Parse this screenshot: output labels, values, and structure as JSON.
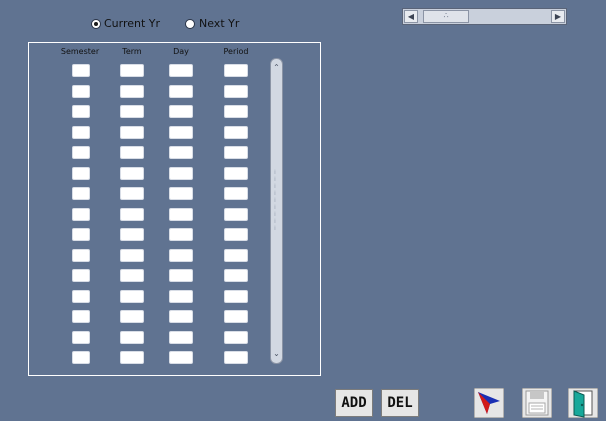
{
  "year_selector": {
    "options": [
      {
        "label": "Current  Yr",
        "checked": true
      },
      {
        "label": "Next  Yr",
        "checked": false
      }
    ]
  },
  "table": {
    "headers": [
      "Semester",
      "Term",
      "Day",
      "Period"
    ],
    "row_count": 15
  },
  "scroll": {
    "h_thumb_glyph": "∴",
    "v_up_glyph": "⌃",
    "v_down_glyph": "⌄",
    "v_grip": "⁞"
  },
  "toolbar": {
    "add_label": "ADD",
    "del_label": "DEL",
    "pointer_icon": "pointer-arrow-icon",
    "save_icon": "floppy-disk-icon",
    "exit_icon": "exit-door-icon"
  },
  "colors": {
    "background": "#607391",
    "cell": "#ffffff"
  }
}
